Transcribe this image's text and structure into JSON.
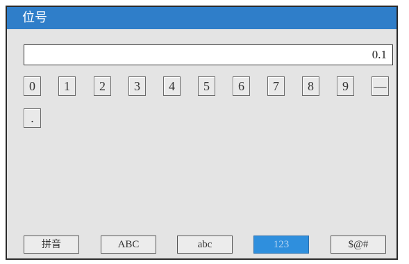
{
  "window": {
    "title": "位号"
  },
  "input": {
    "value": "0.1"
  },
  "keypad": {
    "keys": [
      "0",
      "1",
      "2",
      "3",
      "4",
      "5",
      "6",
      "7",
      "8",
      "9",
      "—",
      "."
    ]
  },
  "modes": {
    "items": [
      "拼音",
      "ABC",
      "abc",
      "123",
      "$@#"
    ],
    "active": "123"
  },
  "colors": {
    "titlebar": "#2f7ec9",
    "panel": "#e4e4e4",
    "active_mode": "#2f8fdd"
  }
}
